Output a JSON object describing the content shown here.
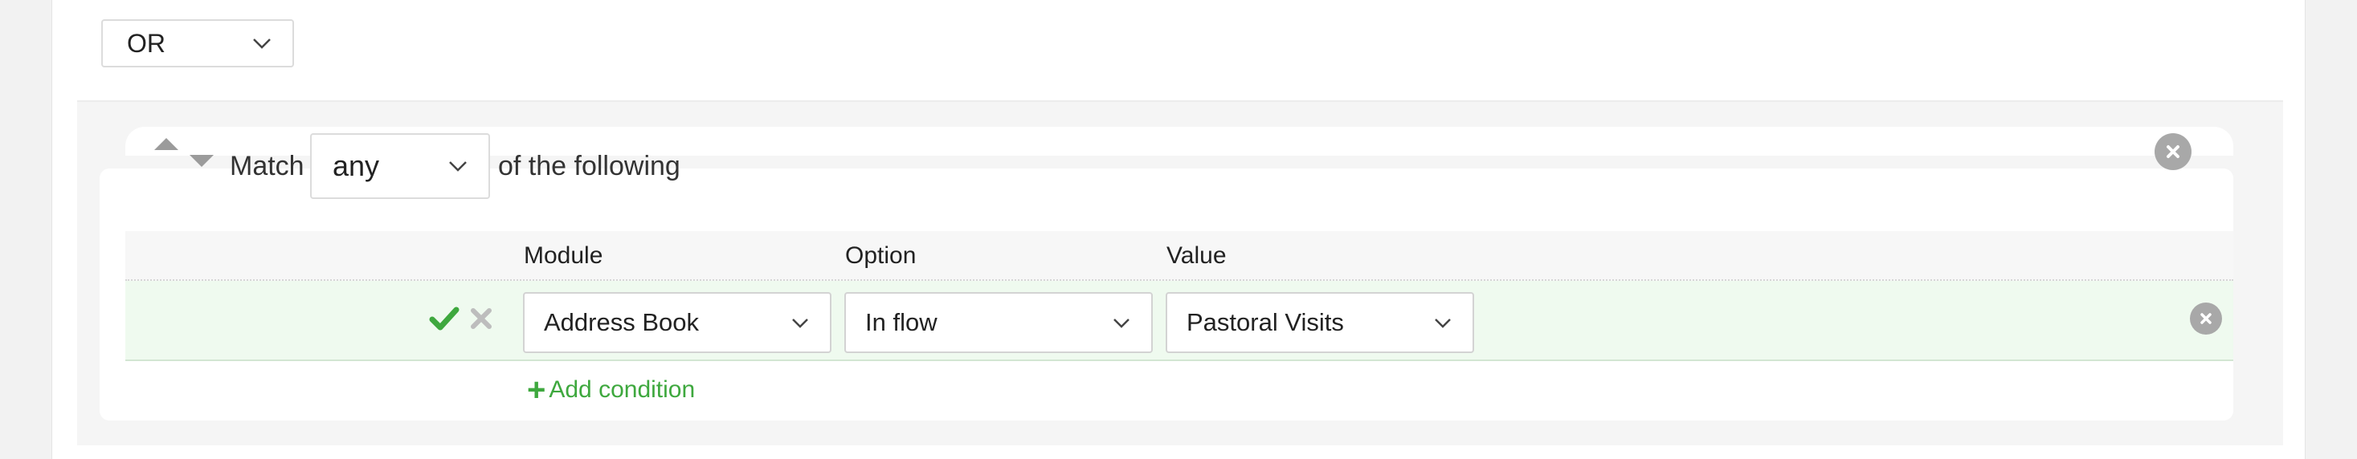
{
  "top_operator": {
    "value": "OR"
  },
  "group": {
    "match_label": "Match",
    "match_value": "any",
    "suffix_label": "of the following"
  },
  "table": {
    "headers": {
      "module": "Module",
      "option": "Option",
      "value": "Value"
    },
    "rows": [
      {
        "module": "Address Book",
        "option": "In flow",
        "value": "Pastoral Visits"
      }
    ]
  },
  "add_condition_label": "Add condition",
  "icons": {
    "sort_up": "caret-up-icon",
    "sort_down": "caret-down-icon",
    "remove_group": "circle-x-icon",
    "confirm": "check-icon",
    "cancel": "x-icon",
    "remove_row": "circle-x-icon",
    "add": "plus-icon",
    "dropdown": "chevron-down-icon"
  },
  "colors": {
    "accent_green": "#3ea83e",
    "row_highlight": "#effaef",
    "icon_gray": "#a8a8a8"
  }
}
